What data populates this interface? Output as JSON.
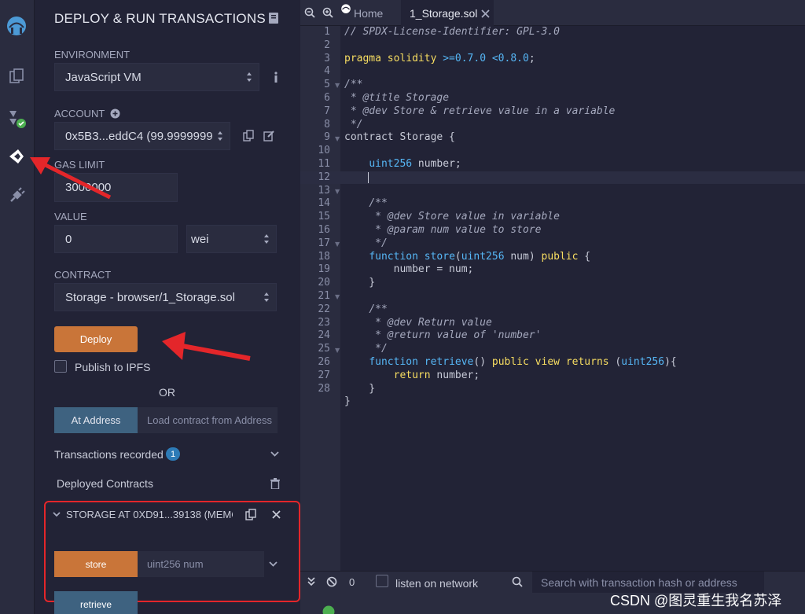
{
  "rail": {
    "icons": [
      "remix-logo-icon",
      "file-explorer-icon",
      "solidity-compiler-icon",
      "deploy-run-icon",
      "plugin-manager-icon"
    ]
  },
  "panel": {
    "title": "DEPLOY & RUN TRANSACTIONS",
    "environment": {
      "label": "ENVIRONMENT",
      "value": "JavaScript VM"
    },
    "account": {
      "label": "ACCOUNT",
      "value": "0x5B3...eddC4 (99.9999999"
    },
    "gas_limit": {
      "label": "GAS LIMIT",
      "value": "3000000"
    },
    "value": {
      "label": "VALUE",
      "amount": "0",
      "unit": "wei"
    },
    "contract": {
      "label": "CONTRACT",
      "value": "Storage - browser/1_Storage.sol"
    },
    "deploy_label": "Deploy",
    "publish_label": "Publish to IPFS",
    "or_label": "OR",
    "at_address_label": "At Address",
    "at_address_placeholder": "Load contract from Address",
    "transactions_recorded_label": "Transactions recorded",
    "transactions_count": "1",
    "deployed_contracts_label": "Deployed Contracts",
    "instance": {
      "title": "STORAGE AT 0XD91...39138 (MEMC",
      "store_label": "store",
      "store_placeholder": "uint256 num",
      "retrieve_label": "retrieve"
    }
  },
  "editor": {
    "tab_home": "Home",
    "tab_file": "1_Storage.sol",
    "line_numbers": [
      "1",
      "2",
      "3",
      "4",
      "5",
      "6",
      "7",
      "8",
      "9",
      "10",
      "11",
      "12",
      "13",
      "14",
      "15",
      "16",
      "17",
      "18",
      "19",
      "20",
      "21",
      "22",
      "23",
      "24",
      "25",
      "26",
      "27",
      "28"
    ]
  },
  "terminal": {
    "count": "0",
    "listen_label": "listen on network",
    "search_placeholder": "Search with transaction hash or address"
  },
  "watermark": "CSDN @图灵重生我名苏泽",
  "colors": {
    "accent_orange": "#c97539",
    "accent_blue": "#3e6280",
    "highlight_red": "#e4262a"
  }
}
